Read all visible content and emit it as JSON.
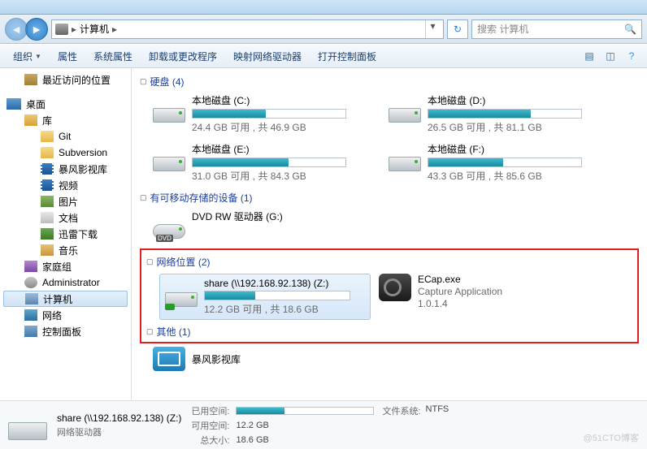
{
  "breadcrumb": {
    "root_icon": "computer",
    "root": "计算机",
    "sep": "▸"
  },
  "search": {
    "placeholder": "搜索 计算机"
  },
  "toolbar": {
    "organize": "组织",
    "properties": "属性",
    "sysprops": "系统属性",
    "uninstall": "卸载或更改程序",
    "mapnet": "映射网络驱动器",
    "opencp": "打开控制面板"
  },
  "sidebar": {
    "recent": "最近访问的位置",
    "desktop": "桌面",
    "libraries": "库",
    "items": [
      {
        "label": "Git"
      },
      {
        "label": "Subversion"
      },
      {
        "label": "暴风影视库"
      },
      {
        "label": "视频"
      },
      {
        "label": "图片"
      },
      {
        "label": "文档"
      },
      {
        "label": "迅雷下载"
      },
      {
        "label": "音乐"
      }
    ],
    "homegroup": "家庭组",
    "admin": "Administrator",
    "computer": "计算机",
    "network": "网络",
    "controlpanel": "控制面板"
  },
  "groups": {
    "hdd": {
      "label": "硬盘 (4)"
    },
    "removable": {
      "label": "有可移动存储的设备 (1)"
    },
    "network": {
      "label": "网络位置 (2)"
    },
    "other": {
      "label": "其他 (1)"
    }
  },
  "drives": [
    {
      "name": "本地磁盘 (C:)",
      "stat": "24.4 GB 可用 , 共 46.9 GB",
      "pct": 48
    },
    {
      "name": "本地磁盘 (D:)",
      "stat": "26.5 GB 可用 , 共 81.1 GB",
      "pct": 67
    },
    {
      "name": "本地磁盘 (E:)",
      "stat": "31.0 GB 可用 , 共 84.3 GB",
      "pct": 63
    },
    {
      "name": "本地磁盘 (F:)",
      "stat": "43.3 GB 可用 , 共 85.6 GB",
      "pct": 49
    }
  ],
  "dvd": {
    "name": "DVD RW 驱动器 (G:)"
  },
  "netdrive": {
    "name": "share (\\\\192.168.92.138) (Z:)",
    "stat": "12.2 GB 可用 , 共 18.6 GB",
    "pct": 35
  },
  "ecap": {
    "name": "ECap.exe",
    "desc": "Capture Application",
    "ver": "1.0.1.4"
  },
  "other_item": {
    "name": "暴风影视库"
  },
  "details": {
    "title": "share (\\\\192.168.92.138) (Z:)",
    "type": "网络驱动器",
    "used_label": "已用空间:",
    "free_label": "可用空间:",
    "free_val": "12.2 GB",
    "total_label": "总大小:",
    "total_val": "18.6 GB",
    "fs_label": "文件系统:",
    "fs_val": "NTFS",
    "pct": 35
  },
  "watermark": "@51CTO博客"
}
